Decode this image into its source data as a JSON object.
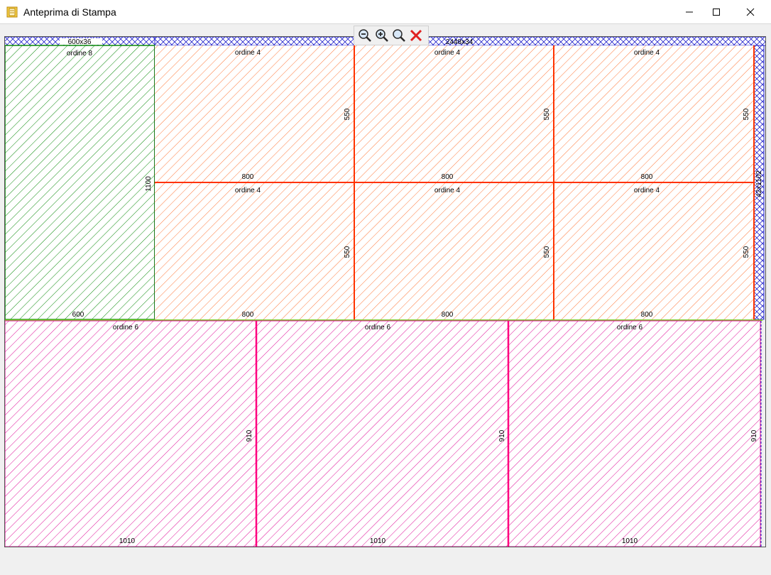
{
  "window": {
    "title": "Anteprima di Stampa",
    "icon": "app-window-icon",
    "controls": [
      "minimize-icon",
      "maximize-icon",
      "close-icon"
    ]
  },
  "toolbar": {
    "buttons": [
      {
        "name": "zoom-out-icon",
        "tooltip": ""
      },
      {
        "name": "zoom-in-icon",
        "tooltip": ""
      },
      {
        "name": "zoom-fit-icon",
        "tooltip": ""
      },
      {
        "name": "close-preview-icon",
        "tooltip": ""
      }
    ]
  },
  "colors": {
    "scrap_hatch": "#2222cc",
    "order8": "#0a8a0a",
    "order4": "#ff7a3d",
    "order4_cut": "#ff3300",
    "order6": "#e0109a",
    "order6_cut": "#ff007f",
    "separator": "#7ccc2b"
  },
  "scrap": {
    "top_left": "600x36",
    "top_right": "2448x34",
    "right": "42x1102"
  },
  "pieces": {
    "order8": {
      "label": "ordine 8",
      "width": "600",
      "height": "1100"
    },
    "order4": [
      {
        "label": "ordine 4",
        "width": "800",
        "height": "550"
      },
      {
        "label": "ordine 4",
        "width": "800",
        "height": "550"
      },
      {
        "label": "ordine 4",
        "width": "800",
        "height": "550"
      },
      {
        "label": "ordine 4",
        "width": "800",
        "height": "550"
      },
      {
        "label": "ordine 4",
        "width": "800",
        "height": "550"
      },
      {
        "label": "ordine 4",
        "width": "800",
        "height": "550"
      }
    ],
    "order6": [
      {
        "label": "ordine 6",
        "width": "1010",
        "height": "910"
      },
      {
        "label": "ordine 6",
        "width": "1010",
        "height": "910"
      },
      {
        "label": "ordine 6",
        "width": "1010",
        "height": "910"
      }
    ]
  }
}
